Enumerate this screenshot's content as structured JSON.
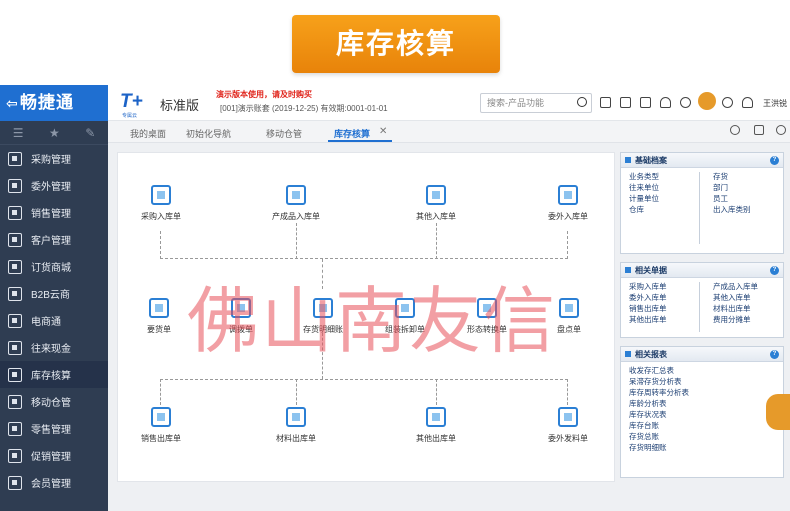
{
  "banner": {
    "title": "库存核算"
  },
  "sidebar": {
    "brand": "畅捷通",
    "items": [
      {
        "label": "采购管理",
        "icon": "purchase-icon"
      },
      {
        "label": "委外管理",
        "icon": "outsource-icon"
      },
      {
        "label": "销售管理",
        "icon": "sales-icon"
      },
      {
        "label": "客户管理",
        "icon": "customer-icon"
      },
      {
        "label": "订货商城",
        "icon": "mall-icon"
      },
      {
        "label": "B2B云商",
        "icon": "b2b-icon"
      },
      {
        "label": "电商通",
        "icon": "ecommerce-icon"
      },
      {
        "label": "往来现金",
        "icon": "cash-icon"
      },
      {
        "label": "库存核算",
        "icon": "inventory-icon"
      },
      {
        "label": "移动仓管",
        "icon": "mobile-warehouse-icon"
      },
      {
        "label": "零售管理",
        "icon": "retail-icon"
      },
      {
        "label": "促销管理",
        "icon": "promotion-icon"
      },
      {
        "label": "会员管理",
        "icon": "member-icon"
      }
    ]
  },
  "topbar": {
    "logo": "T+",
    "logo_sub": "专属云",
    "edition": "标准版",
    "demo_warning": "演示版本使用，请及时购买",
    "account": "[001]演示账套   (2019-12-25)   有效期:0001-01-01",
    "search_placeholder": "搜索-产品功能",
    "username": "王洪锐"
  },
  "tabs": {
    "items": [
      "我的桌面",
      "初始化导航",
      "移动仓管",
      "库存核算"
    ],
    "active": "库存核算"
  },
  "flow": {
    "top_row": [
      {
        "label": "采购入库单",
        "icon": "purchase-inbound-icon"
      },
      {
        "label": "产成品入库单",
        "icon": "product-inbound-icon"
      },
      {
        "label": "其他入库单",
        "icon": "other-inbound-icon"
      },
      {
        "label": "委外入库单",
        "icon": "outsource-inbound-icon"
      }
    ],
    "middle_row": [
      {
        "label": "要货单",
        "icon": "request-icon"
      },
      {
        "label": "调拨单",
        "icon": "transfer-icon"
      },
      {
        "label": "存货明细账",
        "icon": "ledger-icon"
      },
      {
        "label": "组装拆卸单",
        "icon": "assembly-icon"
      },
      {
        "label": "形态转换单",
        "icon": "conversion-icon"
      },
      {
        "label": "盘点单",
        "icon": "stocktake-icon"
      }
    ],
    "bottom_row": [
      {
        "label": "销售出库单",
        "icon": "sales-outbound-icon"
      },
      {
        "label": "材料出库单",
        "icon": "material-outbound-icon"
      },
      {
        "label": "其他出库单",
        "icon": "other-outbound-icon"
      },
      {
        "label": "委外发料单",
        "icon": "outsource-issue-icon"
      }
    ]
  },
  "watermark": "佛山南友信",
  "panels": {
    "basic": {
      "title": "基础档案",
      "left": [
        "业务类型",
        "往来单位",
        "计量单位",
        "仓库"
      ],
      "right": [
        "存货",
        "部门",
        "员工",
        "出入库类别"
      ]
    },
    "docs": {
      "title": "相关单据",
      "left": [
        "采购入库单",
        "委外入库单",
        "销售出库单",
        "其他出库单"
      ],
      "right": [
        "产成品入库单",
        "其他入库单",
        "材料出库单",
        "费用分摊单"
      ]
    },
    "reports": {
      "title": "相关报表",
      "items": [
        "收发存汇总表",
        "呆滞存货分析表",
        "库存周转率分析表",
        "库龄分析表",
        "库存状况表",
        "库存台账",
        "存货总账",
        "存货明细账"
      ]
    }
  }
}
